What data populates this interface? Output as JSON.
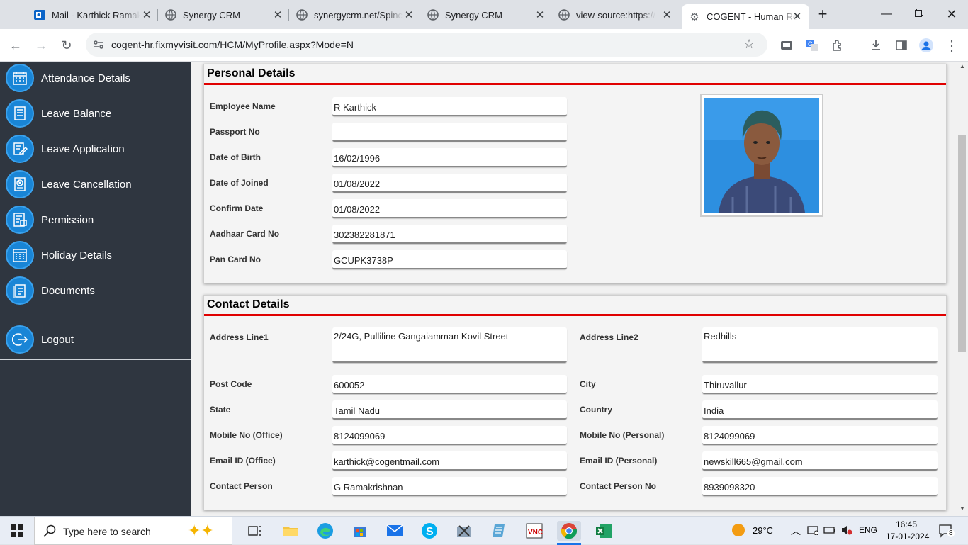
{
  "browser": {
    "tabs": [
      {
        "title": "Mail - Karthick Ramakrishnan",
        "icon": "outlook-icon"
      },
      {
        "title": "Synergy CRM",
        "icon": "globe-icon"
      },
      {
        "title": "synergycrm.net/Spinc",
        "icon": "globe-icon"
      },
      {
        "title": "Synergy CRM",
        "icon": "globe-icon"
      },
      {
        "title": "view-source:https://s",
        "icon": "globe-icon"
      },
      {
        "title": "COGENT - Human Re",
        "icon": "gear-icon"
      }
    ],
    "url": "cogent-hr.fixmyvisit.com/HCM/MyProfile.aspx?Mode=N"
  },
  "sidebar": {
    "items": [
      {
        "label": "Attendance Details",
        "icon": "calendar-icon"
      },
      {
        "label": "Leave Balance",
        "icon": "list-icon"
      },
      {
        "label": "Leave Application",
        "icon": "edit-icon"
      },
      {
        "label": "Leave Cancellation",
        "icon": "cancel-doc-icon"
      },
      {
        "label": "Permission",
        "icon": "permission-doc-icon"
      },
      {
        "label": "Holiday Details",
        "icon": "calendar-grid-icon"
      },
      {
        "label": "Documents",
        "icon": "document-icon"
      }
    ],
    "logout": "Logout"
  },
  "personal": {
    "title": "Personal Details",
    "fields": [
      {
        "label": "Employee Name",
        "value": "R Karthick"
      },
      {
        "label": "Passport No",
        "value": ""
      },
      {
        "label": "Date of Birth",
        "value": "16/02/1996"
      },
      {
        "label": "Date of Joined",
        "value": "01/08/2022"
      },
      {
        "label": "Confirm Date",
        "value": "01/08/2022"
      },
      {
        "label": "Aadhaar Card No",
        "value": "302382281871"
      },
      {
        "label": "Pan Card No",
        "value": "GCUPK3738P"
      }
    ]
  },
  "contact": {
    "title": "Contact Details",
    "left": [
      {
        "label": "Address Line1",
        "value": "2/24G, Pulliline Gangaiamman Kovil Street"
      },
      {
        "label": "Post Code",
        "value": "600052"
      },
      {
        "label": "State",
        "value": "Tamil Nadu"
      },
      {
        "label": "Mobile No (Office)",
        "value": "8124099069"
      },
      {
        "label": "Email ID (Office)",
        "value": "karthick@cogentmail.com"
      },
      {
        "label": "Contact Person",
        "value": "G Ramakrishnan"
      }
    ],
    "right": [
      {
        "label": "Address Line2",
        "value": "Redhills"
      },
      {
        "label": "City",
        "value": "Thiruvallur"
      },
      {
        "label": "Country",
        "value": "India"
      },
      {
        "label": "Mobile No (Personal)",
        "value": "8124099069"
      },
      {
        "label": "Email ID (Personal)",
        "value": "newskill665@gmail.com"
      },
      {
        "label": "Contact Person No",
        "value": "8939098320"
      }
    ]
  },
  "taskbar": {
    "search_placeholder": "Type here to search",
    "weather": "29°C",
    "lang": "ENG",
    "time": "16:45",
    "date": "17-01-2024",
    "notifications": "8"
  }
}
